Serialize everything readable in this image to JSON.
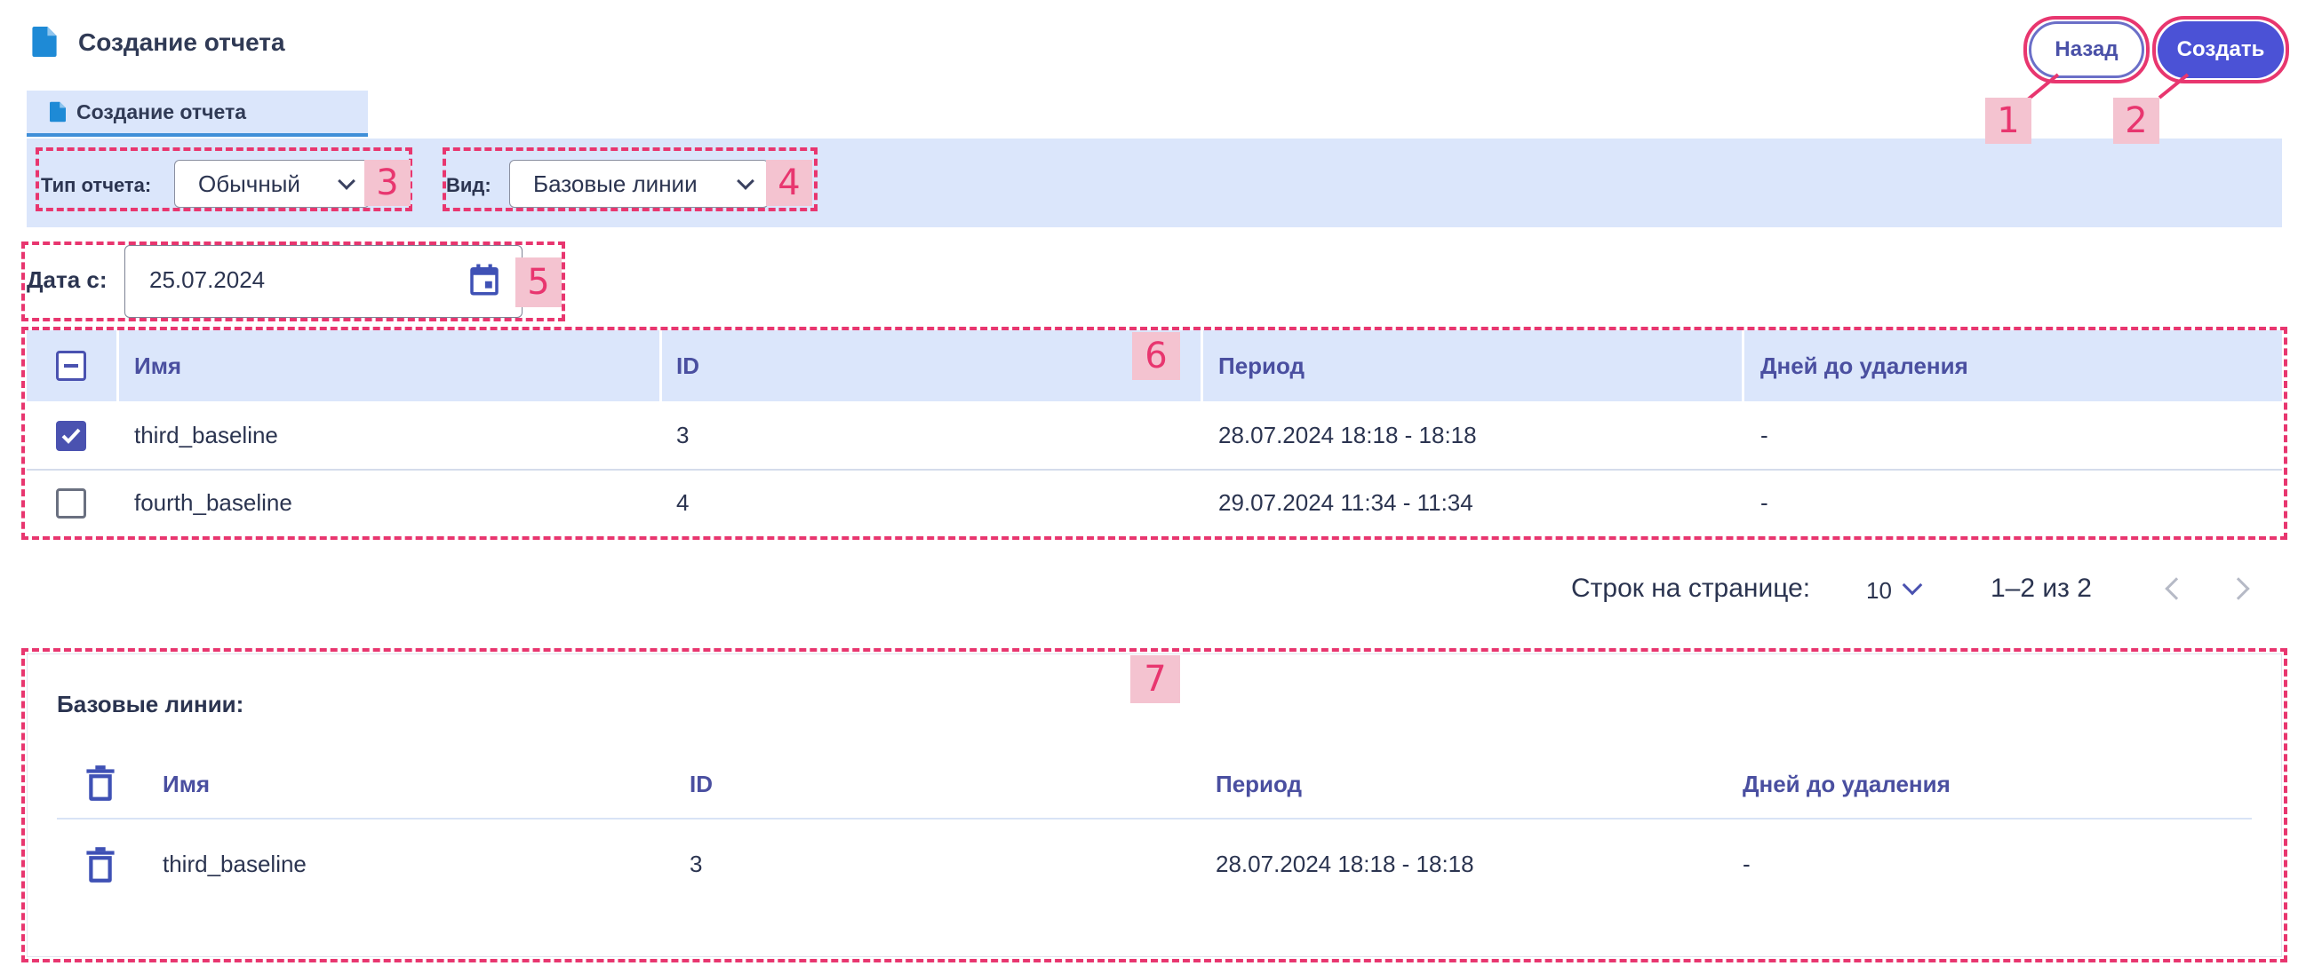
{
  "header": {
    "title": "Создание отчета",
    "back_label": "Назад",
    "create_label": "Создать"
  },
  "tab": {
    "label": "Создание отчета"
  },
  "filters": {
    "report_type_label": "Тип отчета:",
    "report_type_value": "Обычный",
    "view_label": "Вид:",
    "view_value": "Базовые линии"
  },
  "date": {
    "label": "Дата с:",
    "value": "25.07.2024"
  },
  "table": {
    "columns": [
      "Имя",
      "ID",
      "Период",
      "Дней до удаления"
    ],
    "rows": [
      {
        "checked": true,
        "name": "third_baseline",
        "id": "3",
        "period": "28.07.2024 18:18 - 18:18",
        "days": "-"
      },
      {
        "checked": false,
        "name": "fourth_baseline",
        "id": "4",
        "period": "29.07.2024 11:34 - 11:34",
        "days": "-"
      }
    ]
  },
  "pagination": {
    "rows_label": "Строк на странице:",
    "rows_value": "10",
    "range": "1–2 из 2"
  },
  "baselines": {
    "title": "Базовые линии:",
    "columns": [
      "Имя",
      "ID",
      "Период",
      "Дней до удаления"
    ],
    "rows": [
      {
        "name": "third_baseline",
        "id": "3",
        "period": "28.07.2024 18:18 - 18:18",
        "days": "-"
      }
    ]
  },
  "annotations": [
    "1",
    "2",
    "3",
    "4",
    "5",
    "6",
    "7"
  ],
  "colors": {
    "accent": "#4b52d6",
    "highlight": "#e8366f",
    "band": "#dbe6fb"
  }
}
